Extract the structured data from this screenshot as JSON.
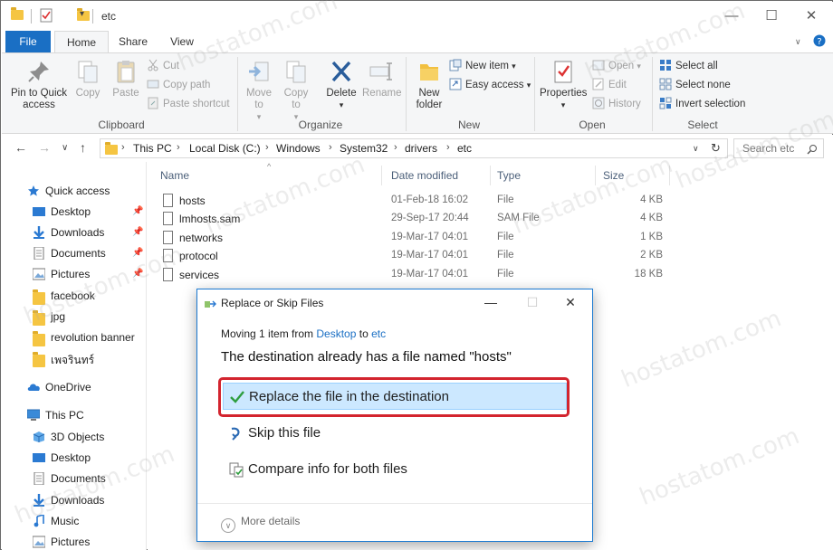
{
  "window": {
    "title": "etc",
    "minimize": "—",
    "maximize": "☐",
    "close": "✕"
  },
  "tabs": {
    "file": "File",
    "home": "Home",
    "share": "Share",
    "view": "View"
  },
  "ribbon": {
    "clipboard": {
      "label": "Clipboard",
      "pin": "Pin to Quick access",
      "copy": "Copy",
      "paste": "Paste",
      "cut": "Cut",
      "copy_path": "Copy path",
      "paste_shortcut": "Paste shortcut"
    },
    "organize": {
      "label": "Organize",
      "move_to": "Move to",
      "copy_to": "Copy to",
      "delete": "Delete",
      "rename": "Rename"
    },
    "new": {
      "label": "New",
      "new_folder": "New folder",
      "new_item": "New item",
      "easy_access": "Easy access"
    },
    "open": {
      "label": "Open",
      "properties": "Properties",
      "open": "Open",
      "edit": "Edit",
      "history": "History"
    },
    "select": {
      "label": "Select",
      "select_all": "Select all",
      "select_none": "Select none",
      "invert": "Invert selection"
    }
  },
  "address": {
    "crumbs": [
      "This PC",
      "Local Disk (C:)",
      "Windows",
      "System32",
      "drivers",
      "etc"
    ],
    "search_placeholder": "Search etc"
  },
  "sidebar": {
    "quick_access": "Quick access",
    "items": [
      {
        "label": "Desktop",
        "pinned": true
      },
      {
        "label": "Downloads",
        "pinned": true
      },
      {
        "label": "Documents",
        "pinned": true
      },
      {
        "label": "Pictures",
        "pinned": true
      },
      {
        "label": "facebook"
      },
      {
        "label": "jpg"
      },
      {
        "label": "revolution banner"
      },
      {
        "label": "เพจรินทร์"
      }
    ],
    "onedrive": "OneDrive",
    "this_pc": "This PC",
    "pc_items": [
      "3D Objects",
      "Desktop",
      "Documents",
      "Downloads",
      "Music",
      "Pictures"
    ]
  },
  "columns": {
    "name": "Name",
    "date": "Date modified",
    "type": "Type",
    "size": "Size"
  },
  "files": [
    {
      "name": "hosts",
      "date": "01-Feb-18 16:02",
      "type": "File",
      "size": "4 KB"
    },
    {
      "name": "lmhosts.sam",
      "date": "29-Sep-17 20:44",
      "type": "SAM File",
      "size": "4 KB"
    },
    {
      "name": "networks",
      "date": "19-Mar-17 04:01",
      "type": "File",
      "size": "1 KB"
    },
    {
      "name": "protocol",
      "date": "19-Mar-17 04:01",
      "type": "File",
      "size": "2 KB"
    },
    {
      "name": "services",
      "date": "19-Mar-17 04:01",
      "type": "File",
      "size": "18 KB"
    }
  ],
  "dialog": {
    "title": "Replace or Skip Files",
    "moving_prefix": "Moving 1 item from",
    "from": "Desktop",
    "to_word": "to",
    "to": "etc",
    "message": "The destination already has a file named \"hosts\"",
    "replace": "Replace the file in the destination",
    "skip": "Skip this file",
    "compare": "Compare info for both files",
    "more": "More details"
  },
  "watermark": "hostatom.com",
  "colors": {
    "accent": "#1a6fc4",
    "highlight_border": "#d3242e",
    "selected_bg": "#cce8ff",
    "check": "#2e9e3e"
  }
}
